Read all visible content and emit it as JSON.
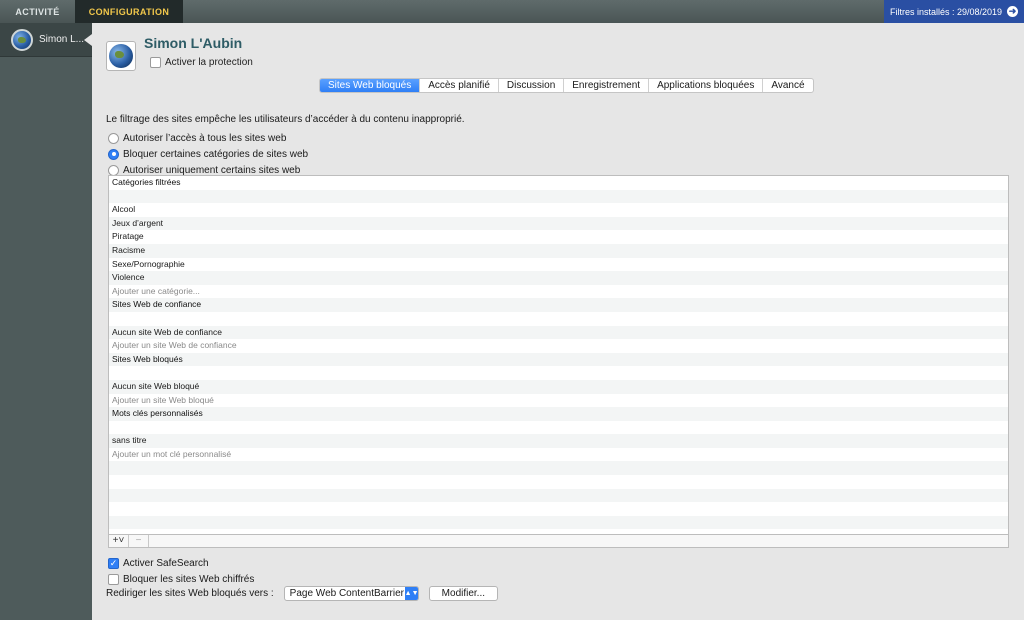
{
  "topbar": {
    "tabs": [
      {
        "label": "ACTIVITÉ"
      },
      {
        "label": "CONFIGURATION"
      }
    ],
    "filters_label": "Filtres installés : 29/08/2019",
    "filters_icon": "arrow-right-circle-icon"
  },
  "sidebar": {
    "user_label": "Simon L..."
  },
  "user": {
    "name": "Simon L'Aubin",
    "protection_label": "Activer la protection",
    "protection_checked": false
  },
  "tabs": [
    {
      "label": "Sites Web bloqués",
      "active": true
    },
    {
      "label": "Accès planifié"
    },
    {
      "label": "Discussion"
    },
    {
      "label": "Enregistrement"
    },
    {
      "label": "Applications bloquées"
    },
    {
      "label": "Avancé"
    }
  ],
  "description": "Le filtrage des sites empêche les utilisateurs d’accéder à du contenu inapproprié.",
  "radios": [
    {
      "label": "Autoriser l’accès à tous les sites web",
      "checked": false
    },
    {
      "label": "Bloquer certaines catégories de sites web",
      "checked": true
    },
    {
      "label": "Autoriser uniquement certains sites web",
      "checked": false
    }
  ],
  "table_rows": [
    {
      "text": "Catégories filtrées",
      "kind": "header"
    },
    {
      "text": "",
      "kind": "blank"
    },
    {
      "text": "Alcool",
      "kind": "item"
    },
    {
      "text": "Jeux d’argent",
      "kind": "item"
    },
    {
      "text": "Piratage",
      "kind": "item"
    },
    {
      "text": "Racisme",
      "kind": "item"
    },
    {
      "text": "Sexe/Pornographie",
      "kind": "item"
    },
    {
      "text": "Violence",
      "kind": "item"
    },
    {
      "text": "Ajouter une catégorie...",
      "kind": "placeholder"
    },
    {
      "text": "Sites Web de confiance",
      "kind": "header"
    },
    {
      "text": "",
      "kind": "blank"
    },
    {
      "text": "Aucun site Web de confiance",
      "kind": "item"
    },
    {
      "text": "Ajouter un site Web de confiance",
      "kind": "placeholder"
    },
    {
      "text": "Sites Web bloqués",
      "kind": "header"
    },
    {
      "text": "",
      "kind": "blank"
    },
    {
      "text": "Aucun site Web bloqué",
      "kind": "item"
    },
    {
      "text": "Ajouter un site Web bloqué",
      "kind": "placeholder"
    },
    {
      "text": "Mots clés personnalisés",
      "kind": "header"
    },
    {
      "text": "",
      "kind": "blank"
    },
    {
      "text": "sans titre",
      "kind": "item"
    },
    {
      "text": "Ajouter un mot clé personnalisé",
      "kind": "placeholder"
    }
  ],
  "toolbar": {
    "add_label": "+˅",
    "remove_label": "−"
  },
  "options": {
    "safesearch_label": "Activer SafeSearch",
    "safesearch_checked": true,
    "encrypted_label": "Bloquer les sites Web chiffrés",
    "encrypted_checked": false
  },
  "redirect": {
    "label": "Rediriger les sites Web bloqués vers :",
    "selected": "Page Web ContentBarrier",
    "modify_label": "Modifier..."
  }
}
